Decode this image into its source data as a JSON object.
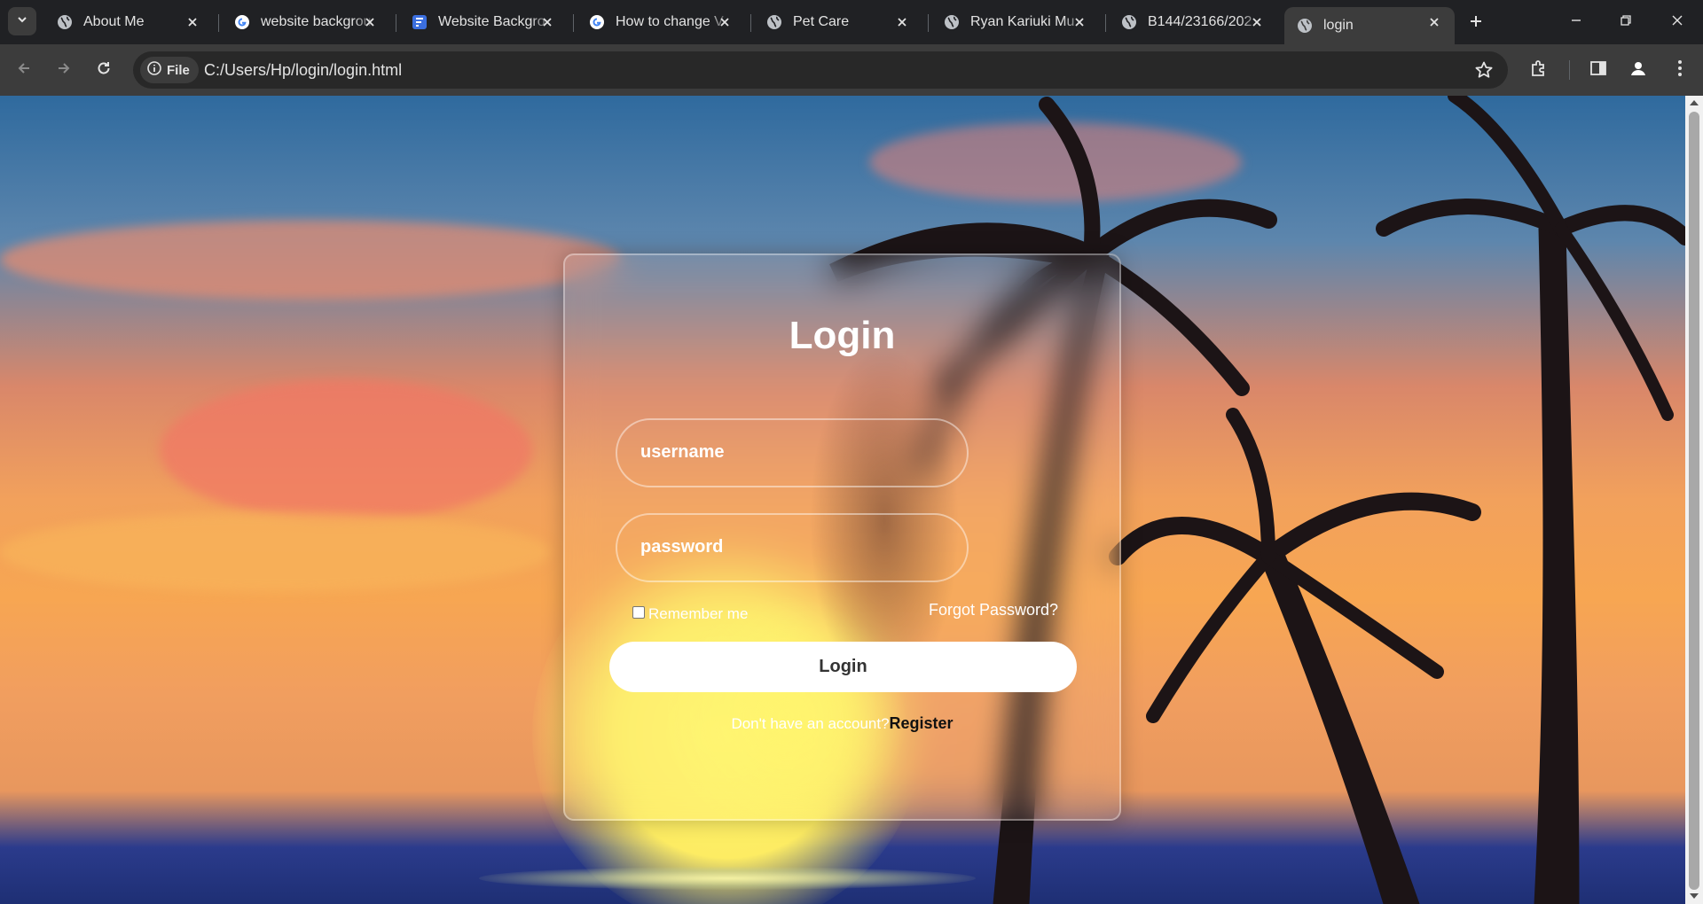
{
  "browser": {
    "tabs": [
      {
        "title": "About Me",
        "icon": "globe-icon"
      },
      {
        "title": "website backgrou",
        "icon": "google-icon"
      },
      {
        "title": "Website Backgro",
        "icon": "forms-icon"
      },
      {
        "title": "How to change V",
        "icon": "google-icon"
      },
      {
        "title": "Pet Care",
        "icon": "globe-icon"
      },
      {
        "title": "Ryan Kariuki Mu",
        "icon": "globe-icon"
      },
      {
        "title": "B144/23166/202",
        "icon": "globe-icon"
      },
      {
        "title": "login",
        "icon": "globe-icon",
        "active": true
      }
    ],
    "address": {
      "chip_label": "File",
      "url": "C:/Users/Hp/login/login.html"
    }
  },
  "login": {
    "title": "Login",
    "username_placeholder": "username",
    "password_placeholder": "password",
    "remember_label": "Remember me",
    "forgot_label": "Forgot Password?",
    "button_label": "Login",
    "no_account_text": "Don't have an account?",
    "register_label": "Register"
  }
}
